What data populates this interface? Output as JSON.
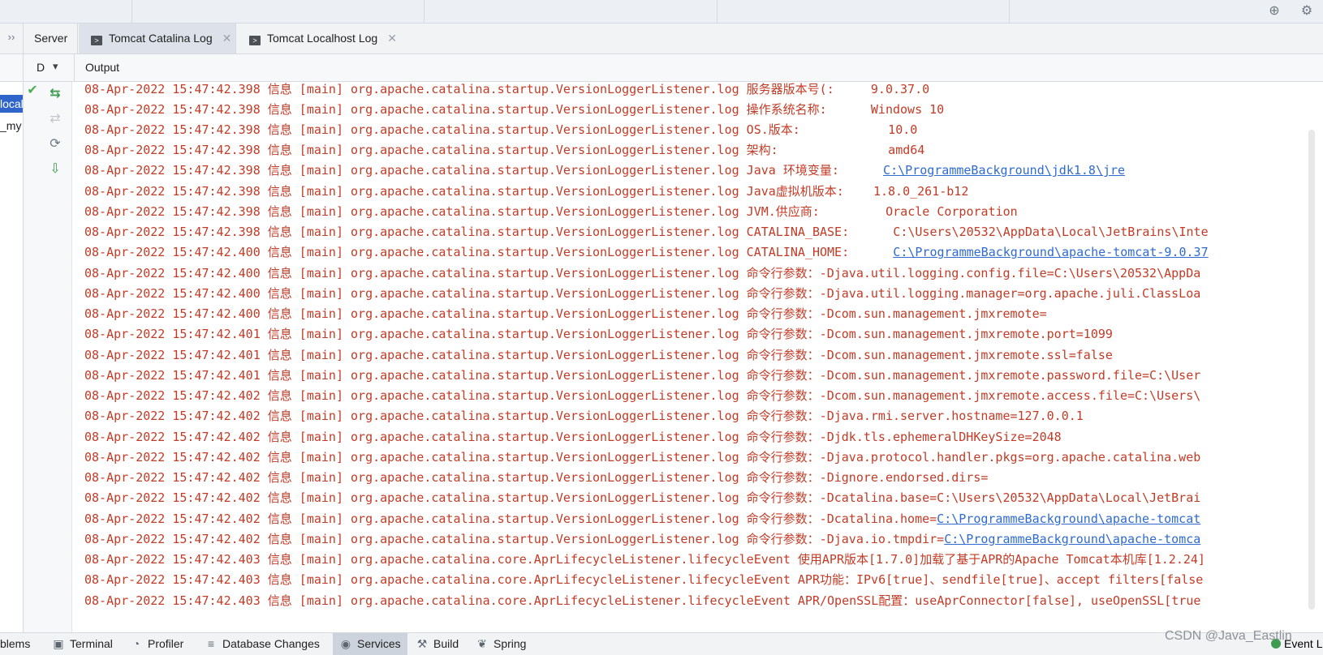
{
  "tabs": [
    {
      "label": "Server",
      "icon": "",
      "closable": false,
      "active": false
    },
    {
      "label": "Tomcat Catalina Log",
      "icon": "terminal-icon",
      "closable": true,
      "active": true
    },
    {
      "label": "Tomcat Localhost Log",
      "icon": "terminal-icon",
      "closable": true,
      "active": false
    }
  ],
  "subheader": {
    "d_label": "D",
    "output_label": "Output"
  },
  "left_panel": {
    "selected_item": "localhost",
    "item2": "_my"
  },
  "log_lines": [
    {
      "text": "08-Apr-2022 15:47:42.398 信息 [main] org.apache.catalina.startup.VersionLoggerListener.log 服务器版本号(:     9.0.37.0",
      "link": ""
    },
    {
      "text": "08-Apr-2022 15:47:42.398 信息 [main] org.apache.catalina.startup.VersionLoggerListener.log 操作系统名称:      Windows 10",
      "link": ""
    },
    {
      "text": "08-Apr-2022 15:47:42.398 信息 [main] org.apache.catalina.startup.VersionLoggerListener.log OS.版本:            10.0",
      "link": ""
    },
    {
      "text": "08-Apr-2022 15:47:42.398 信息 [main] org.apache.catalina.startup.VersionLoggerListener.log 架构:               amd64",
      "link": ""
    },
    {
      "text": "08-Apr-2022 15:47:42.398 信息 [main] org.apache.catalina.startup.VersionLoggerListener.log Java 环境变量:      ",
      "link": "C:\\ProgrammeBackground\\jdk1.8\\jre"
    },
    {
      "text": "08-Apr-2022 15:47:42.398 信息 [main] org.apache.catalina.startup.VersionLoggerListener.log Java虚拟机版本:    1.8.0_261-b12",
      "link": ""
    },
    {
      "text": "08-Apr-2022 15:47:42.398 信息 [main] org.apache.catalina.startup.VersionLoggerListener.log JVM.供应商:         Oracle Corporation",
      "link": ""
    },
    {
      "text": "08-Apr-2022 15:47:42.398 信息 [main] org.apache.catalina.startup.VersionLoggerListener.log CATALINA_BASE:      C:\\Users\\20532\\AppData\\Local\\JetBrains\\Inte",
      "link": ""
    },
    {
      "text": "08-Apr-2022 15:47:42.400 信息 [main] org.apache.catalina.startup.VersionLoggerListener.log CATALINA_HOME:      ",
      "link": "C:\\ProgrammeBackground\\apache-tomcat-9.0.37"
    },
    {
      "text": "08-Apr-2022 15:47:42.400 信息 [main] org.apache.catalina.startup.VersionLoggerListener.log 命令行参数：-Djava.util.logging.config.file=C:\\Users\\20532\\AppDa",
      "link": ""
    },
    {
      "text": "08-Apr-2022 15:47:42.400 信息 [main] org.apache.catalina.startup.VersionLoggerListener.log 命令行参数：-Djava.util.logging.manager=org.apache.juli.ClassLoa",
      "link": ""
    },
    {
      "text": "08-Apr-2022 15:47:42.400 信息 [main] org.apache.catalina.startup.VersionLoggerListener.log 命令行参数：-Dcom.sun.management.jmxremote=",
      "link": ""
    },
    {
      "text": "08-Apr-2022 15:47:42.401 信息 [main] org.apache.catalina.startup.VersionLoggerListener.log 命令行参数：-Dcom.sun.management.jmxremote.port=1099",
      "link": ""
    },
    {
      "text": "08-Apr-2022 15:47:42.401 信息 [main] org.apache.catalina.startup.VersionLoggerListener.log 命令行参数：-Dcom.sun.management.jmxremote.ssl=false",
      "link": ""
    },
    {
      "text": "08-Apr-2022 15:47:42.401 信息 [main] org.apache.catalina.startup.VersionLoggerListener.log 命令行参数：-Dcom.sun.management.jmxremote.password.file=C:\\User",
      "link": ""
    },
    {
      "text": "08-Apr-2022 15:47:42.402 信息 [main] org.apache.catalina.startup.VersionLoggerListener.log 命令行参数：-Dcom.sun.management.jmxremote.access.file=C:\\Users\\",
      "link": ""
    },
    {
      "text": "08-Apr-2022 15:47:42.402 信息 [main] org.apache.catalina.startup.VersionLoggerListener.log 命令行参数：-Djava.rmi.server.hostname=127.0.0.1",
      "link": ""
    },
    {
      "text": "08-Apr-2022 15:47:42.402 信息 [main] org.apache.catalina.startup.VersionLoggerListener.log 命令行参数：-Djdk.tls.ephemeralDHKeySize=2048",
      "link": ""
    },
    {
      "text": "08-Apr-2022 15:47:42.402 信息 [main] org.apache.catalina.startup.VersionLoggerListener.log 命令行参数：-Djava.protocol.handler.pkgs=org.apache.catalina.web",
      "link": ""
    },
    {
      "text": "08-Apr-2022 15:47:42.402 信息 [main] org.apache.catalina.startup.VersionLoggerListener.log 命令行参数：-Dignore.endorsed.dirs=",
      "link": ""
    },
    {
      "text": "08-Apr-2022 15:47:42.402 信息 [main] org.apache.catalina.startup.VersionLoggerListener.log 命令行参数：-Dcatalina.base=C:\\Users\\20532\\AppData\\Local\\JetBrai",
      "link": ""
    },
    {
      "text": "08-Apr-2022 15:47:42.402 信息 [main] org.apache.catalina.startup.VersionLoggerListener.log 命令行参数：-Dcatalina.home=",
      "link": "C:\\ProgrammeBackground\\apache-tomcat"
    },
    {
      "text": "08-Apr-2022 15:47:42.402 信息 [main] org.apache.catalina.startup.VersionLoggerListener.log 命令行参数：-Djava.io.tmpdir=",
      "link": "C:\\ProgrammeBackground\\apache-tomca"
    },
    {
      "text": "08-Apr-2022 15:47:42.403 信息 [main] org.apache.catalina.core.AprLifecycleListener.lifecycleEvent 使用APR版本[1.7.0]加载了基于APR的Apache Tomcat本机库[1.2.24]",
      "link": ""
    },
    {
      "text": "08-Apr-2022 15:47:42.403 信息 [main] org.apache.catalina.core.AprLifecycleListener.lifecycleEvent APR功能：IPv6[true]、sendfile[true]、accept filters[false",
      "link": ""
    },
    {
      "text": "08-Apr-2022 15:47:42.403 信息 [main] org.apache.catalina.core.AprLifecycleListener.lifecycleEvent APR/OpenSSL配置：useAprConnector[false], useOpenSSL[true",
      "link": ""
    }
  ],
  "bottom_tabs": [
    {
      "label": "blems",
      "icon": "problems-icon",
      "active": false
    },
    {
      "label": "Terminal",
      "icon": "terminal-icon",
      "active": false
    },
    {
      "label": "Profiler",
      "icon": "profiler-icon",
      "active": false
    },
    {
      "label": "Database Changes",
      "icon": "database-changes-icon",
      "active": false
    },
    {
      "label": "Services",
      "icon": "services-icon",
      "active": true
    },
    {
      "label": "Build",
      "icon": "build-icon",
      "active": false
    },
    {
      "label": "Spring",
      "icon": "spring-icon",
      "active": false
    }
  ],
  "event_log_label": "Event L",
  "watermark": "CSDN @Java_Eastlin",
  "colors": {
    "log_text": "#c33b26",
    "link": "#2f6bd1",
    "selection": "#2f65ca",
    "success": "#4caf50"
  }
}
